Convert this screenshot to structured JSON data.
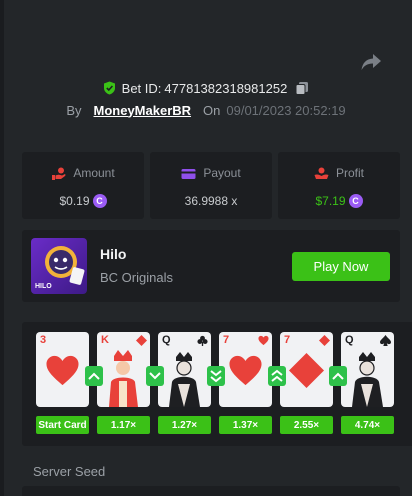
{
  "header": {
    "bet_label": "Bet ID:",
    "bet_id": "47781382318981252",
    "by_label": "By",
    "username": "MoneyMakerBR",
    "on_label": "On",
    "datetime": "09/01/2023 20:52:19"
  },
  "stats": {
    "amount": {
      "label": "Amount",
      "value": "$0.19"
    },
    "payout": {
      "label": "Payout",
      "value": "36.9988 x"
    },
    "profit": {
      "label": "Profit",
      "value": "$7.19"
    }
  },
  "game": {
    "name": "Hilo",
    "provider": "BC Originals",
    "thumb_tag": "HILO",
    "play_label": "Play Now"
  },
  "cards": [
    {
      "rank": "3",
      "suit": "hearts",
      "color": "red",
      "multiplier": "Start Card"
    },
    {
      "rank": "K",
      "suit": "diamonds",
      "color": "red",
      "multiplier": "1.17×",
      "arrow": "up"
    },
    {
      "rank": "Q",
      "suit": "clubs",
      "color": "black",
      "multiplier": "1.27×",
      "arrow": "down"
    },
    {
      "rank": "7",
      "suit": "hearts",
      "color": "red",
      "multiplier": "1.37×",
      "arrow": "down-double"
    },
    {
      "rank": "7",
      "suit": "diamonds",
      "color": "red",
      "multiplier": "2.55×",
      "arrow": "up-double"
    },
    {
      "rank": "Q",
      "suit": "spades",
      "color": "black",
      "multiplier": "4.74×",
      "arrow": "up"
    }
  ],
  "server_seed_label": "Server Seed",
  "colors": {
    "accent_green": "#3bc117",
    "profit_green": "#3bc117",
    "coin_purple": "#9b5cf5",
    "panel": "#1c1e21",
    "background": "#232629"
  }
}
